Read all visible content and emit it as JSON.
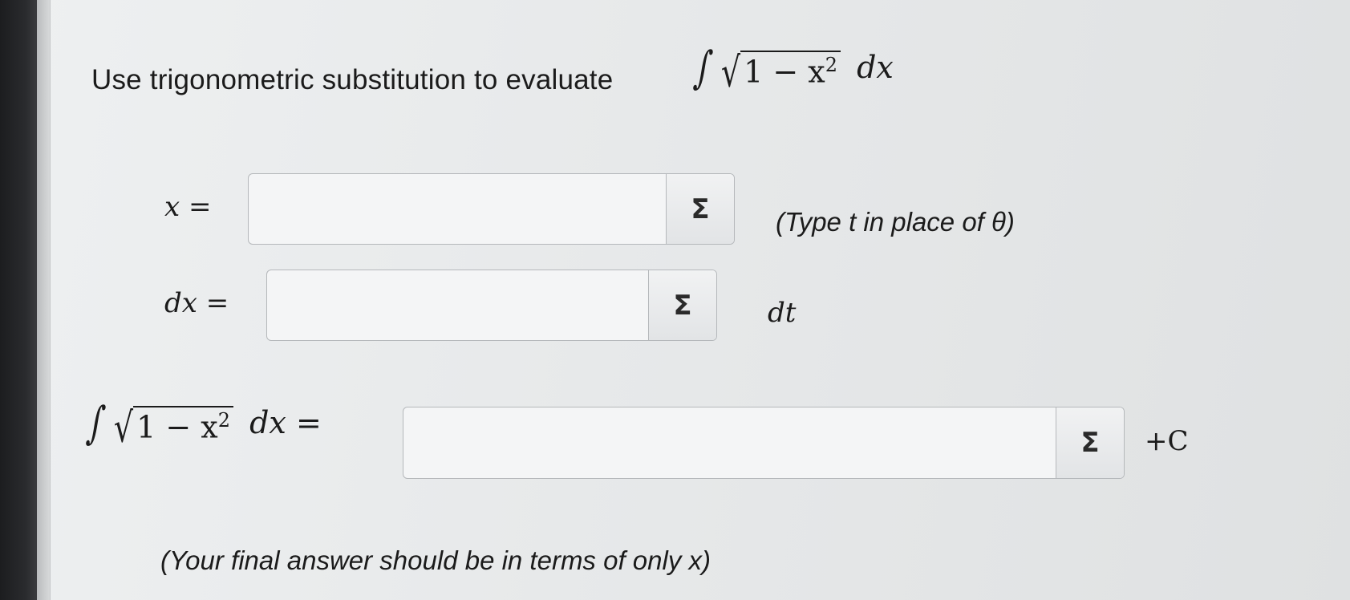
{
  "prompt": {
    "text": "Use trigonometric substitution to evaluate",
    "integrand": "1 − x",
    "power": "2",
    "differential": "dx"
  },
  "row_x": {
    "label": "x =",
    "input_value": "",
    "button": "Σ",
    "hint": "(Type t in place of θ)"
  },
  "row_dx": {
    "label": "dx =",
    "input_value": "",
    "button": "Σ",
    "suffix": "dt"
  },
  "row_integral": {
    "integrand": "1 − x",
    "power": "2",
    "differential": "dx =",
    "input_value": "",
    "button": "Σ",
    "suffix": "+C"
  },
  "footer_note": "(Your final answer should be in terms of only x)"
}
